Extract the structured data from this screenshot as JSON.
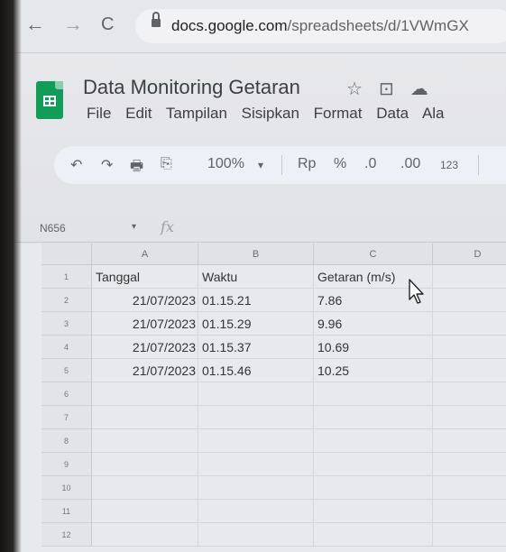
{
  "browser": {
    "url": "docs.google.com/spreadsheets/d/1VWmGX",
    "url_host": "docs.google.com",
    "url_path": "/spreadsheets/d/1VWmGX"
  },
  "document": {
    "title": "Data Monitoring Getaran",
    "menu": [
      "File",
      "Edit",
      "Tampilan",
      "Sisipkan",
      "Format",
      "Data",
      "Ala"
    ]
  },
  "toolbar": {
    "undo": "↶",
    "redo": "↷",
    "print": "🖶",
    "paint_format": "⎘",
    "zoom": "100%",
    "zoom_caret": "▾",
    "currency": "Rp",
    "percent": "%",
    "decrease_decimal": ".0",
    "increase_decimal": ".00",
    "number_format": "123"
  },
  "formula_bar": {
    "name_box": "N656",
    "caret": "▾",
    "fx": "fx"
  },
  "sheet": {
    "columns": [
      "A",
      "B",
      "C",
      "D"
    ],
    "rows": [
      {
        "num": "1",
        "a": "Tanggal",
        "b": "Waktu",
        "c": "Getaran (m/s)"
      },
      {
        "num": "2",
        "a": "21/07/2023",
        "b": "01.15.21",
        "c": "7.86"
      },
      {
        "num": "3",
        "a": "21/07/2023",
        "b": "01.15.29",
        "c": "9.96"
      },
      {
        "num": "4",
        "a": "21/07/2023",
        "b": "01.15.37",
        "c": "10.69"
      },
      {
        "num": "5",
        "a": "21/07/2023",
        "b": "01.15.46",
        "c": "10.25"
      },
      {
        "num": "6",
        "a": "",
        "b": "",
        "c": ""
      },
      {
        "num": "7",
        "a": "",
        "b": "",
        "c": ""
      },
      {
        "num": "8",
        "a": "",
        "b": "",
        "c": ""
      },
      {
        "num": "9",
        "a": "",
        "b": "",
        "c": ""
      },
      {
        "num": "10",
        "a": "",
        "b": "",
        "c": ""
      },
      {
        "num": "11",
        "a": "",
        "b": "",
        "c": ""
      },
      {
        "num": "12",
        "a": "",
        "b": "",
        "c": ""
      }
    ]
  }
}
